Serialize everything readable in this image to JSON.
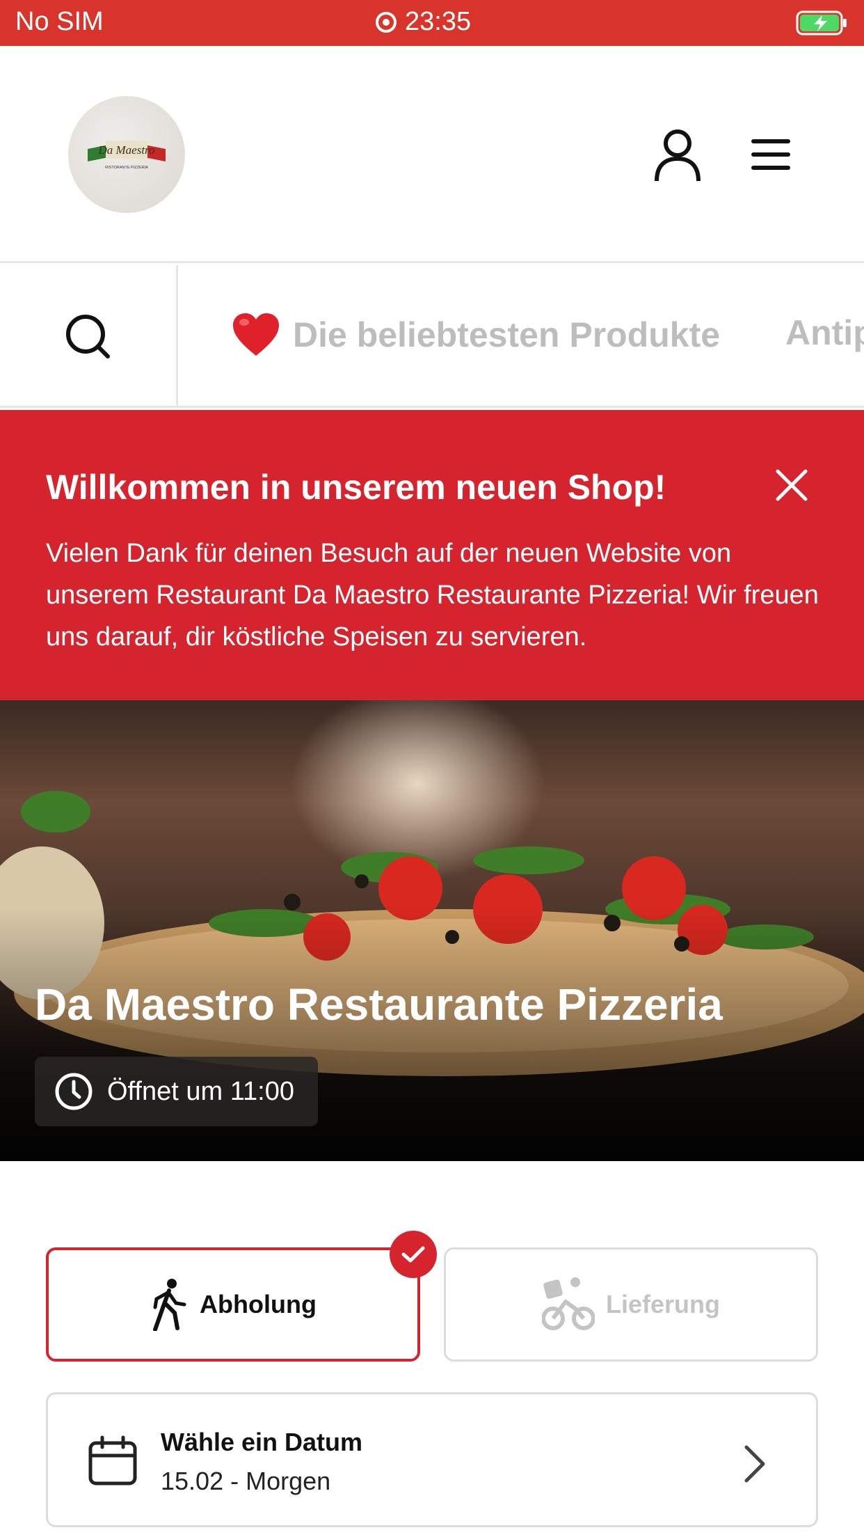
{
  "status_bar": {
    "carrier": "No SIM",
    "time": "23:35"
  },
  "header": {
    "logo_text": "Da Maestro",
    "logo_subtext": "RISTORANTE PIZZERIA"
  },
  "categories": [
    {
      "emoji": "❤️",
      "label": "Die beliebtesten Produkte"
    },
    {
      "label": "Antip"
    }
  ],
  "banner": {
    "title": "Willkommen in unserem neuen Shop!",
    "text": "Vielen Dank für deinen Besuch auf der neuen Website von unserem Restaurant Da Maestro Restaurante Pizzeria! Wir freuen uns darauf, dir köstliche Speisen zu servieren."
  },
  "hero": {
    "title": "Da Maestro Restaurante Pizzeria",
    "opening": "Öffnet um 11:00"
  },
  "order_mode": {
    "pickup_label": "Abholung",
    "delivery_label": "Lieferung",
    "selected": "pickup"
  },
  "date_selector": {
    "title": "Wähle ein Datum",
    "value": "15.02 - Morgen"
  },
  "colors": {
    "status_bar": "#d9342b",
    "accent": "#d6242e",
    "muted_text": "#bdbdbd"
  }
}
